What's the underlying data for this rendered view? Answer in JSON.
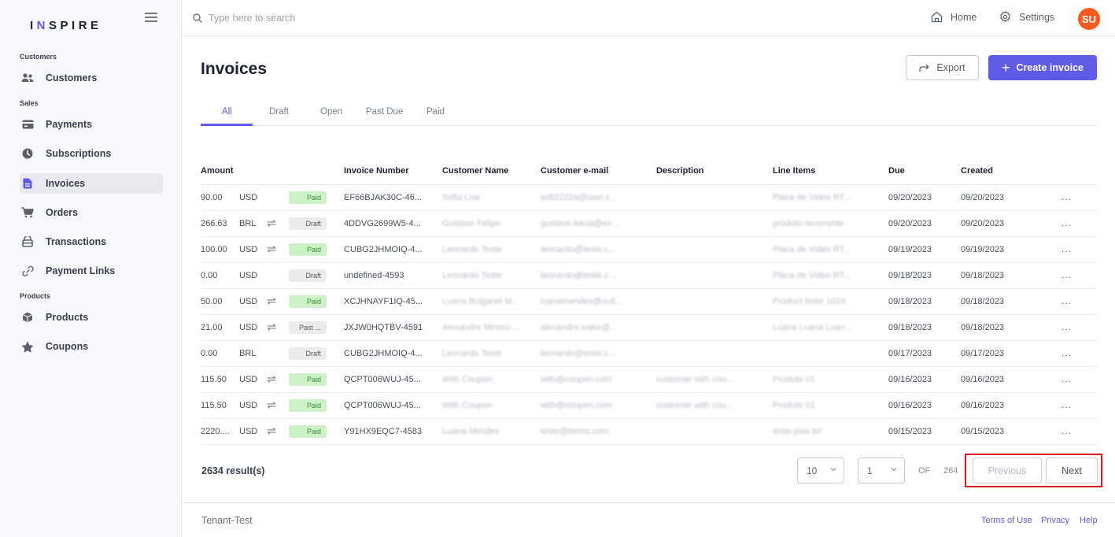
{
  "brand": {
    "prefix": "I",
    "accent": "N",
    "rest": "SPIRE"
  },
  "sidebar": {
    "sections": [
      {
        "label": "Customers"
      },
      {
        "label": "Sales"
      },
      {
        "label": "Products"
      }
    ],
    "items": [
      {
        "label": "Customers",
        "icon": "users-icon"
      },
      {
        "label": "Payments",
        "icon": "card-icon"
      },
      {
        "label": "Subscriptions",
        "icon": "clock-icon"
      },
      {
        "label": "Invoices",
        "icon": "invoice-icon",
        "active": true
      },
      {
        "label": "Orders",
        "icon": "cart-icon"
      },
      {
        "label": "Transactions",
        "icon": "wallet-icon"
      },
      {
        "label": "Payment Links",
        "icon": "link-icon"
      },
      {
        "label": "Products",
        "icon": "box-icon"
      },
      {
        "label": "Coupons",
        "icon": "star-icon"
      }
    ]
  },
  "topbar": {
    "search_placeholder": "Type here to search",
    "home_label": "Home",
    "settings_label": "Settings",
    "avatar_initials": "SU"
  },
  "page": {
    "title": "Invoices",
    "export_label": "Export",
    "create_label": "Create invoice"
  },
  "tabs": [
    {
      "label": "All",
      "active": true
    },
    {
      "label": "Draft"
    },
    {
      "label": "Open"
    },
    {
      "label": "Past Due"
    },
    {
      "label": "Paid"
    }
  ],
  "table": {
    "headers": [
      "Amount",
      "Invoice Number",
      "Customer Name",
      "Customer e-mail",
      "Description",
      "Line Items",
      "Due",
      "Created"
    ],
    "rows": [
      {
        "amount": "90.00",
        "currency": "USD",
        "recurring": false,
        "status": "Paid",
        "status_type": "paid",
        "invoice": "EF66BJAK30C-46...",
        "name": "Sofia Lise",
        "email": "sofi2222a@user.c...",
        "description": "",
        "line_items": "Placa de Video RT...",
        "due": "09/20/2023",
        "created": "09/20/2023"
      },
      {
        "amount": "266.63",
        "currency": "BRL",
        "recurring": true,
        "status": "Draft",
        "status_type": "draft",
        "invoice": "4DDVG2699W5-4...",
        "name": "Gustavo Felipe",
        "email": "gustavo.lokua@ex...",
        "description": "",
        "line_items": "produto recorrente",
        "due": "09/20/2023",
        "created": "09/20/2023"
      },
      {
        "amount": "100.00",
        "currency": "USD",
        "recurring": true,
        "status": "Paid",
        "status_type": "paid",
        "invoice": "CUBG2JHMOIQ-4...",
        "name": "Leonardo Teste",
        "email": "leonardo@teste.c...",
        "description": "",
        "line_items": "Placa de Video RT...",
        "due": "09/19/2023",
        "created": "09/19/2023"
      },
      {
        "amount": "0.00",
        "currency": "USD",
        "recurring": false,
        "status": "Draft",
        "status_type": "draft",
        "invoice": "undefined-4593",
        "name": "Leonardo Teste",
        "email": "leonardo@teste.c...",
        "description": "",
        "line_items": "Placa de Video RT...",
        "due": "09/18/2023",
        "created": "09/18/2023"
      },
      {
        "amount": "50.00",
        "currency": "USD",
        "recurring": true,
        "status": "Paid",
        "status_type": "paid",
        "invoice": "XCJHNAYF1IQ-45...",
        "name": "Luana Bulgareli M...",
        "email": "luanamendes@outl...",
        "description": "",
        "line_items": "Product teste 1010",
        "due": "09/18/2023",
        "created": "09/18/2023"
      },
      {
        "amount": "21.00",
        "currency": "USD",
        "recurring": true,
        "status": "Past ...",
        "status_type": "pastdue",
        "invoice": "JXJW0HQTBV-4591",
        "name": "Alexandre Minoru ...",
        "email": "alexandre.wake@...",
        "description": "",
        "line_items": "Luana Luana Luan...",
        "due": "09/18/2023",
        "created": "09/18/2023"
      },
      {
        "amount": "0.00",
        "currency": "BRL",
        "recurring": false,
        "status": "Draft",
        "status_type": "draft",
        "invoice": "CUBG2JHMOIQ-4...",
        "name": "Leonardo Teste",
        "email": "leonardo@teste.c...",
        "description": "",
        "line_items": "",
        "due": "09/17/2023",
        "created": "09/17/2023"
      },
      {
        "amount": "115.50",
        "currency": "USD",
        "recurring": true,
        "status": "Paid",
        "status_type": "paid",
        "invoice": "QCPT006WUJ-45...",
        "name": "With Coupon",
        "email": "with@coupon.com",
        "description": "customer with cou...",
        "line_items": "Produto 01",
        "due": "09/16/2023",
        "created": "09/16/2023"
      },
      {
        "amount": "115.50",
        "currency": "USD",
        "recurring": true,
        "status": "Paid",
        "status_type": "paid",
        "invoice": "QCPT006WUJ-45...",
        "name": "With Coupon",
        "email": "with@coupon.com",
        "description": "customer with cou...",
        "line_items": "Produto 01",
        "due": "09/16/2023",
        "created": "09/16/2023"
      },
      {
        "amount": "2220....",
        "currency": "USD",
        "recurring": true,
        "status": "Paid",
        "status_type": "paid",
        "invoice": "Y91HX9EQC7-4583",
        "name": "Luana Mendes",
        "email": "teste@terms.com",
        "description": "",
        "line_items": "teste jose bri",
        "due": "09/15/2023",
        "created": "09/15/2023"
      }
    ],
    "more_label": "..."
  },
  "pagination": {
    "results": "2634 result(s)",
    "page_size": "10",
    "current_page": "1",
    "of_label": "OF",
    "total_pages": "264",
    "previous_label": "Previous",
    "next_label": "Next"
  },
  "footer": {
    "tenant": "Tenant-Test",
    "terms": "Terms of Use",
    "privacy": "Privacy",
    "help": "Help"
  },
  "colors": {
    "accent": "#5e5ce6",
    "paid_bg": "#cdf2c7",
    "avatar": "#ff5a1f",
    "highlight": "#e0161b"
  }
}
